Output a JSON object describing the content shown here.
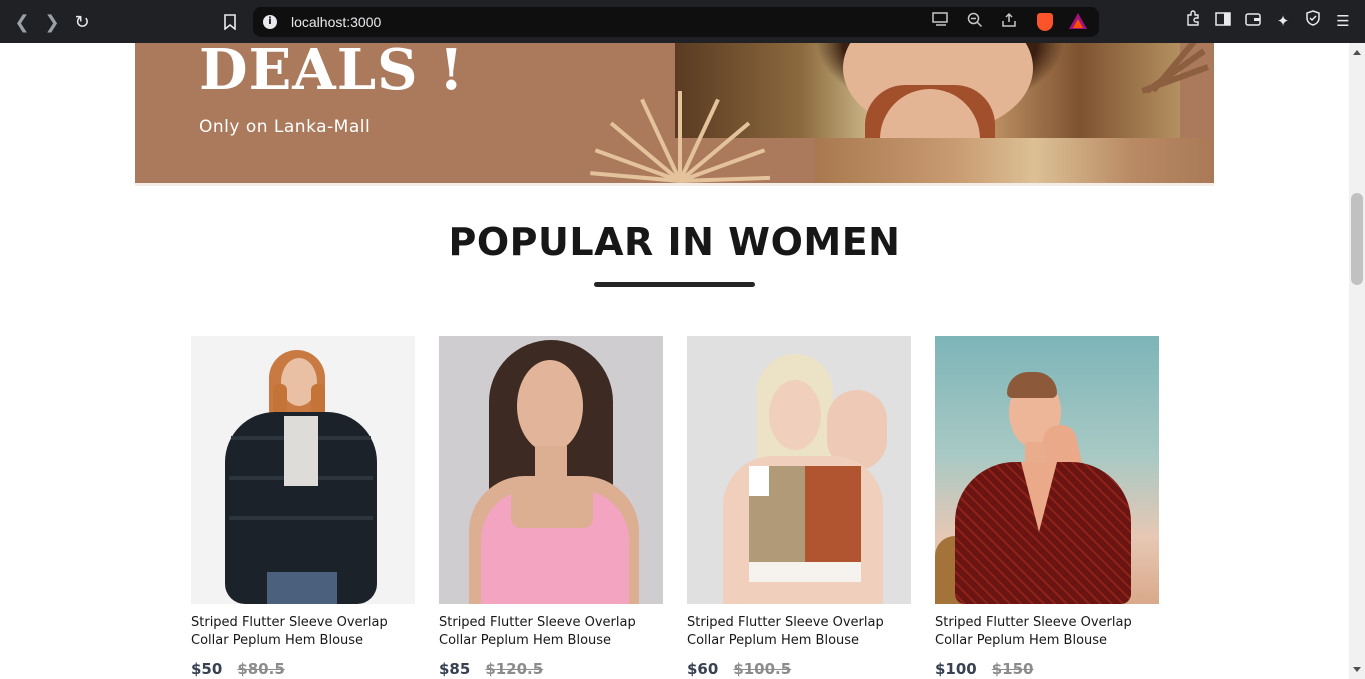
{
  "browser": {
    "url": "localhost:3000",
    "back_icon": "chevron-left-icon",
    "forward_icon": "chevron-right-icon",
    "reload_icon": "reload-icon",
    "bookmark_icon": "bookmark-icon",
    "site_info_icon": "info-icon",
    "url_actions": [
      "cast-icon",
      "zoom-out-icon",
      "share-icon",
      "brave-shield-icon",
      "brave-rewards-icon"
    ],
    "toolbar_icons": [
      "extensions-icon",
      "sidebar-icon",
      "wallet-icon",
      "leo-ai-icon",
      "vpn-icon",
      "menu-icon"
    ]
  },
  "hero": {
    "title": "DEALS !",
    "subtitle": "Only on Lanka-Mall",
    "bg_color": "#ab7a5c"
  },
  "section": {
    "title": "POPULAR IN WOMEN"
  },
  "products": [
    {
      "name": "Striped Flutter Sleeve Overlap Collar Peplum Hem Blouse",
      "new_price": "$50",
      "old_price": "$80.5",
      "image": "woman-black-fur-jacket"
    },
    {
      "name": "Striped Flutter Sleeve Overlap Collar Peplum Hem Blouse",
      "new_price": "$85",
      "old_price": "$120.5",
      "image": "woman-pink-top"
    },
    {
      "name": "Striped Flutter Sleeve Overlap Collar Peplum Hem Blouse",
      "new_price": "$60",
      "old_price": "$100.5",
      "image": "woman-sports-bra"
    },
    {
      "name": "Striped Flutter Sleeve Overlap Collar Peplum Hem Blouse",
      "new_price": "$100",
      "old_price": "$150",
      "image": "woman-red-blouse"
    }
  ],
  "colors": {
    "chrome_bg": "#202124",
    "heading": "#171717",
    "price_new": "#374151",
    "price_old": "#8c8c8c"
  }
}
